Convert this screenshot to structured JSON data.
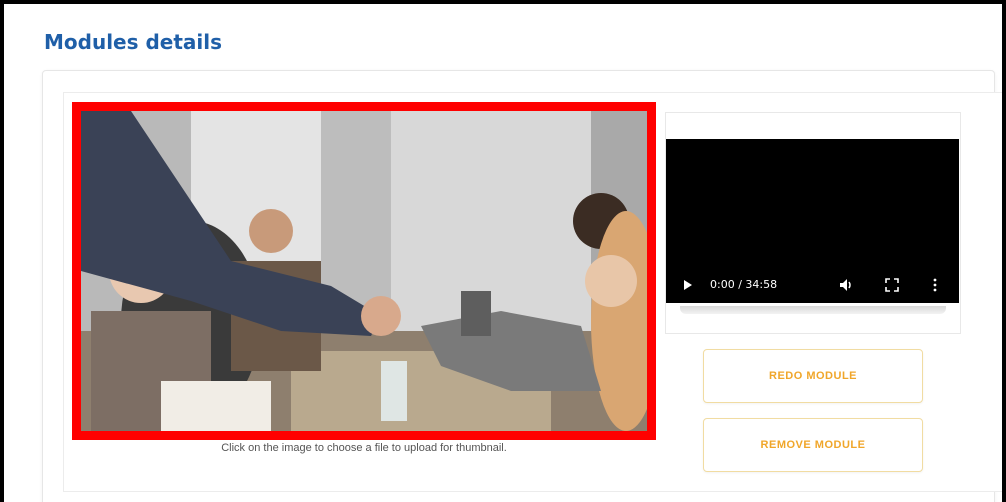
{
  "page": {
    "title": "Modules details"
  },
  "thumbnail": {
    "hint": "Click on the image to choose a file to upload for thumbnail.",
    "highlight_color": "#ff0000"
  },
  "video": {
    "time": "0:00 / 34:58",
    "icons": [
      "play-icon",
      "volume-icon",
      "fullscreen-icon",
      "more-icon"
    ]
  },
  "actions": {
    "redo_label": "REDO MODULE",
    "remove_label": "REMOVE MODULE",
    "accent": "#f0a62a"
  },
  "colors": {
    "title": "#1f5fa8",
    "highlight": "#ff0000"
  }
}
